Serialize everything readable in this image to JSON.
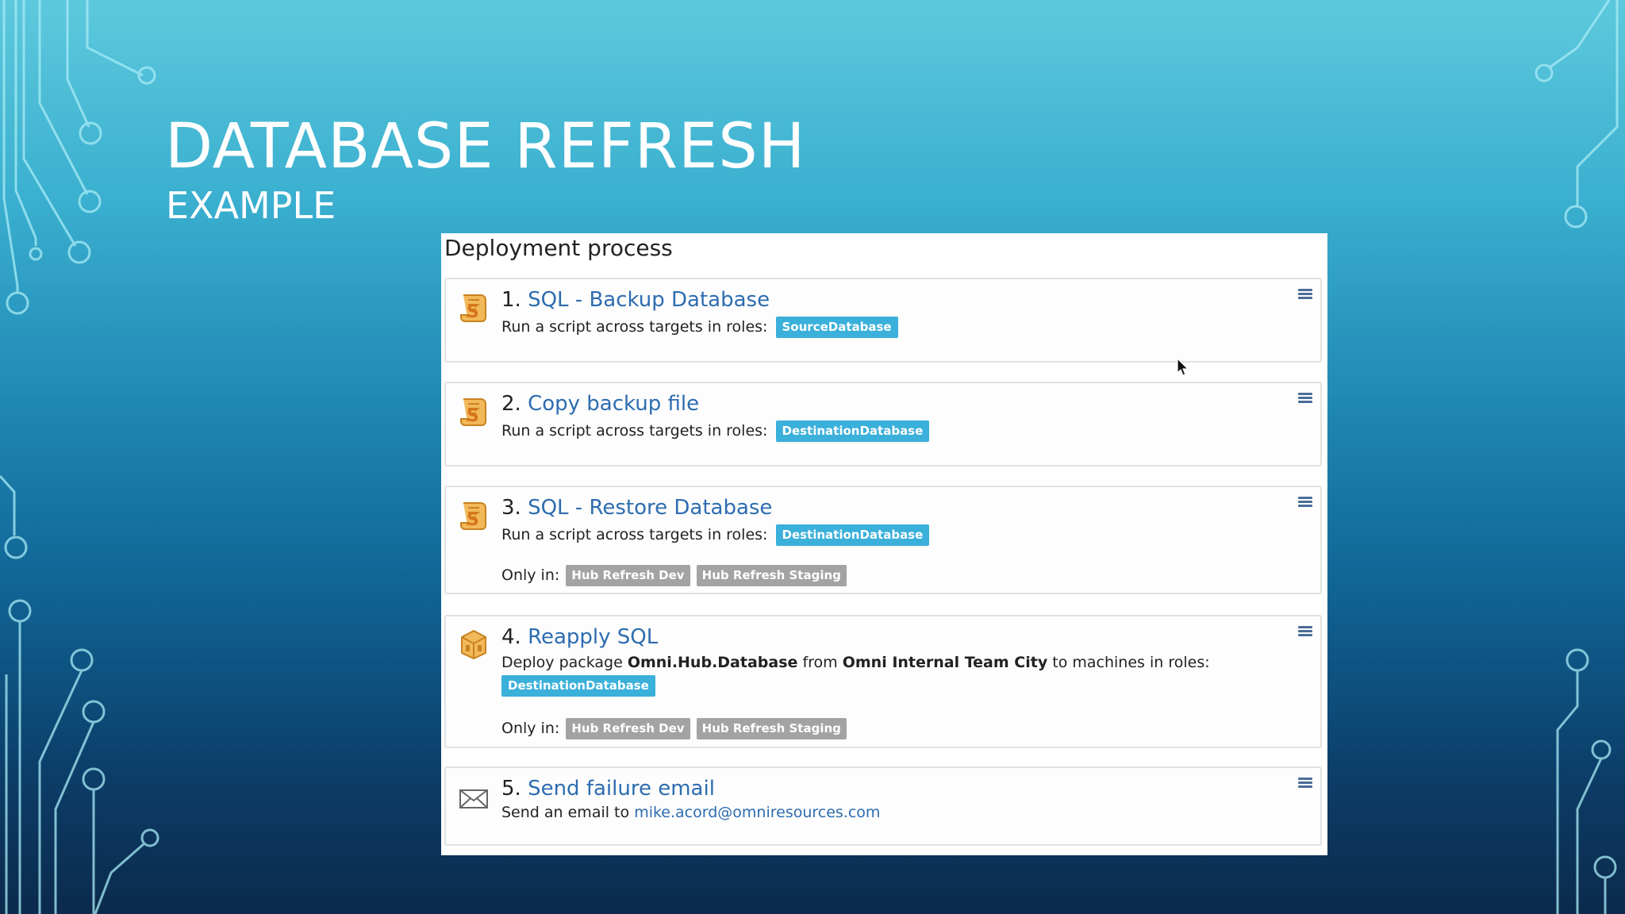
{
  "slide": {
    "title": "DATABASE REFRESH",
    "subtitle": "EXAMPLE"
  },
  "panel": {
    "header": "Deployment process",
    "steps": [
      {
        "number": "1.",
        "title": "SQL - Backup Database",
        "description": "Run a script across targets in roles:",
        "roles": [
          "SourceDatabase"
        ],
        "icon": "script-icon"
      },
      {
        "number": "2.",
        "title": "Copy backup file",
        "description": "Run a script across targets in roles:",
        "roles": [
          "DestinationDatabase"
        ],
        "icon": "script-icon"
      },
      {
        "number": "3.",
        "title": "SQL - Restore Database",
        "description": "Run a script across targets in roles:",
        "roles": [
          "DestinationDatabase"
        ],
        "only_in_label": "Only in:",
        "environments": [
          "Hub Refresh Dev",
          "Hub Refresh Staging"
        ],
        "icon": "script-icon"
      },
      {
        "number": "4.",
        "title": "Reapply SQL",
        "desc_prefix": "Deploy package",
        "package": "Omni.Hub.Database",
        "desc_from": "from",
        "feed": "Omni Internal Team City",
        "desc_suffix": "to machines in roles:",
        "roles": [
          "DestinationDatabase"
        ],
        "only_in_label": "Only in:",
        "environments": [
          "Hub Refresh Dev",
          "Hub Refresh Staging"
        ],
        "icon": "package-icon"
      },
      {
        "number": "5.",
        "title": "Send failure email",
        "desc_prefix": "Send an email to",
        "email": "mike.acord@omniresources.com",
        "icon": "envelope-icon"
      }
    ]
  },
  "colors": {
    "link": "#2d6cb0",
    "role_tag": "#3ab0da",
    "environment_tag": "#a3a3a3",
    "script_icon": "#e8a33a"
  }
}
